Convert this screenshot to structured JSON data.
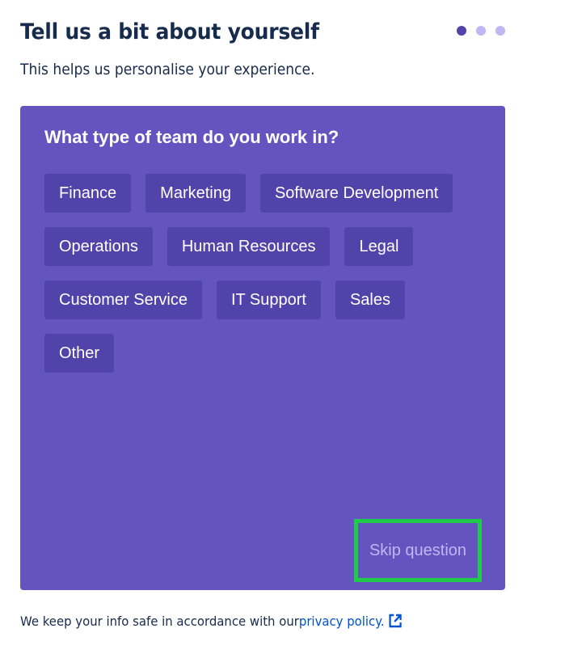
{
  "header": {
    "title": "Tell us a bit about yourself",
    "subtitle": "This helps us personalise your experience."
  },
  "progress": {
    "total_steps": 3,
    "current_step": 1
  },
  "card": {
    "question": "What type of team do you work in?",
    "options": [
      "Finance",
      "Marketing",
      "Software Development",
      "Operations",
      "Human Resources",
      "Legal",
      "Customer Service",
      "IT Support",
      "Sales",
      "Other"
    ],
    "skip_label": "Skip question"
  },
  "footer": {
    "text": "We keep your info safe in accordance with our ",
    "link_label": "privacy policy.",
    "link_icon": "external-link-icon"
  },
  "colors": {
    "card_bg": "#6554c0",
    "option_bg": "#5243aa",
    "dot_active": "#5243aa",
    "dot_inactive": "#c0b6f2",
    "highlight_outline": "#1fcc4a",
    "link": "#0052cc"
  }
}
